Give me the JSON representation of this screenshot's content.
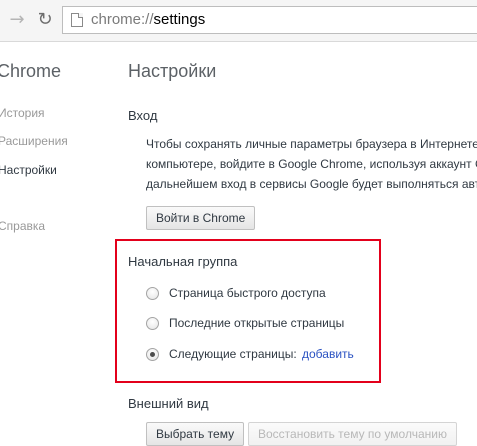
{
  "toolbar": {
    "forward_icon": "arrow-right-icon",
    "reload_icon": "reload-icon",
    "url_scheme": "chrome://",
    "url_path": "settings"
  },
  "sidebar": {
    "brand": "Chrome",
    "items": [
      {
        "label": "История",
        "active": false
      },
      {
        "label": "Расширения",
        "active": false
      },
      {
        "label": "Настройки",
        "active": true
      },
      {
        "label": "Справка",
        "active": false
      }
    ]
  },
  "main": {
    "title": "Настройки",
    "signin": {
      "title": "Вход",
      "text_lines": [
        "Чтобы сохранять личные параметры браузера в Интернете",
        "компьютере, войдите в Google Chrome, используя аккаунт G",
        "дальнейшем вход в сервисы Google будет выполняться авто"
      ],
      "button": "Войти в Chrome"
    },
    "startup": {
      "title": "Начальная группа",
      "options": [
        {
          "label": "Страница быстрого доступа",
          "checked": false
        },
        {
          "label": "Последние открытые страницы",
          "checked": false
        },
        {
          "label": "Следующие страницы:",
          "checked": true
        }
      ],
      "add_link": "добавить"
    },
    "appearance": {
      "title": "Внешний вид",
      "choose_theme_button": "Выбрать тему",
      "reset_theme_button": "Восстановить тему по умолчанию"
    }
  },
  "colors": {
    "highlight_border": "#e3001b",
    "link": "#2a52c2"
  }
}
